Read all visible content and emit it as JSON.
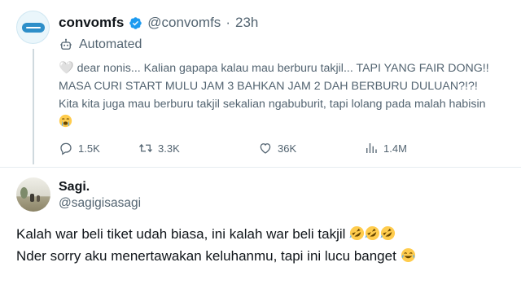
{
  "tweet1": {
    "name": "convomfs",
    "handle": "@convomfs",
    "separator": "·",
    "time": "23h",
    "automated_label": "Automated",
    "heart_glyph": "🤍",
    "text": "dear nonis... Kalian gapapa kalau mau berburu takjil... TAPI YANG FAIR DONG!! MASA CURI START MULU JAM 3 BAHKAN JAM 2 DAH BERBURU DULUAN?!?! Kita kita juga mau berburu takjil sekalian ngabuburit, tapi lolang pada malah habisin",
    "emoji": "loudly-crying-face",
    "actions": {
      "replies": "1.5K",
      "reposts": "3.3K",
      "likes": "36K",
      "views": "1.4M"
    }
  },
  "tweet2": {
    "name": "Sagi.",
    "handle": "@sagigisasagi",
    "line1": "Kalah war beli tiket udah biasa, ini kalah war beli takjil",
    "line1_emoji": "rolling-on-floor-laughing x3",
    "line2": "Nder sorry aku menertawakan keluhanmu, tapi ini lucu banget",
    "line2_emoji": "face-with-tears-of-joy"
  },
  "colors": {
    "text_primary": "#0f1419",
    "text_secondary": "#536471",
    "verified_blue": "#1d9bf0",
    "divider": "#e6ecf0"
  }
}
